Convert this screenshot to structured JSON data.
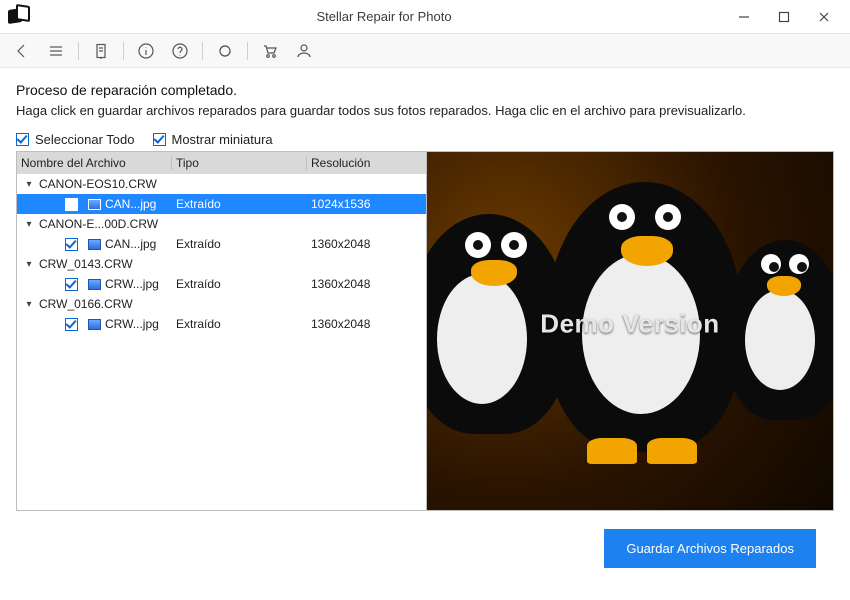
{
  "window": {
    "title": "Stellar Repair for Photo"
  },
  "heading": "Proceso de reparación completado.",
  "subtext": "Haga click en guardar archivos reparados para guardar todos sus fotos reparados. Haga clic en el archivo para previsualizarlo.",
  "options": {
    "select_all": "Seleccionar Todo",
    "show_thumb": "Mostrar miniatura"
  },
  "columns": {
    "name": "Nombre del Archivo",
    "type": "Tipo",
    "resolution": "Resolución"
  },
  "tree": [
    {
      "name": "CANON-EOS10.CRW",
      "expanded": true,
      "children": [
        {
          "name": "CAN...jpg",
          "type": "Extraído",
          "resolution": "1024x1536",
          "selected": true,
          "checked": true
        }
      ]
    },
    {
      "name": "CANON-E...00D.CRW",
      "expanded": true,
      "children": [
        {
          "name": "CAN...jpg",
          "type": "Extraído",
          "resolution": "1360x2048",
          "checked": true
        }
      ]
    },
    {
      "name": "CRW_0143.CRW",
      "expanded": true,
      "children": [
        {
          "name": "CRW...jpg",
          "type": "Extraído",
          "resolution": "1360x2048",
          "checked": true
        }
      ]
    },
    {
      "name": "CRW_0166.CRW",
      "expanded": true,
      "children": [
        {
          "name": "CRW...jpg",
          "type": "Extraído",
          "resolution": "1360x2048",
          "checked": true
        }
      ]
    }
  ],
  "watermark": "Demo Version",
  "save_button": "Guardar Archivos Reparados"
}
